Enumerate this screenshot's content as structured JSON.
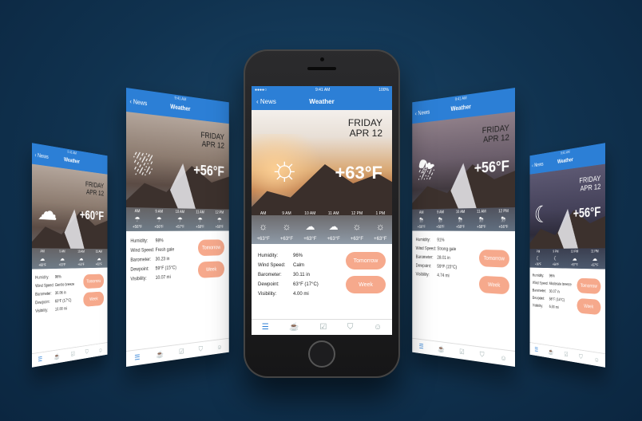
{
  "colors": {
    "accent": "#2c7fd6",
    "button": "#f6a98c",
    "background": "#10324f"
  },
  "screens": [
    {
      "status_time": "9:41 AM",
      "status_battery": "100%",
      "back": "News",
      "title": "Weather",
      "day": "FRIDAY",
      "date": "APR 12",
      "icon": "cloudy-icon",
      "temp": "+60°F",
      "hours": [
        {
          "time": "AM",
          "temp": "+60°F"
        },
        {
          "time": "9 AM",
          "temp": "+60°F"
        },
        {
          "time": "10 AM",
          "temp": "+63°F"
        },
        {
          "time": "11 AM",
          "temp": "+63°F"
        }
      ],
      "details": [
        {
          "key": "Humidity:",
          "val": "96%"
        },
        {
          "key": "Wind Speed:",
          "val": "Gentle breeze"
        },
        {
          "key": "Barometer:",
          "val": "30.06 in"
        },
        {
          "key": "Dewpoint:",
          "val": "63°F (17°C)"
        },
        {
          "key": "Visibility:",
          "val": "10.00 mi"
        }
      ],
      "buttons": [
        "Tomorrow",
        "Week"
      ]
    },
    {
      "status_time": "9:41 AM",
      "status_battery": "100%",
      "back": "News",
      "title": "Weather",
      "day": "FRIDAY",
      "date": "APR 12",
      "icon": "rain-icon",
      "temp": "+56°F",
      "hours": [
        {
          "time": "AM",
          "temp": "+56°F"
        },
        {
          "time": "9 AM",
          "temp": "+56°F"
        },
        {
          "time": "10 AM",
          "temp": "+57°F"
        },
        {
          "time": "11 AM",
          "temp": "+58°F"
        },
        {
          "time": "12 PM",
          "temp": "+58°F"
        }
      ],
      "details": [
        {
          "key": "Humidity:",
          "val": "98%"
        },
        {
          "key": "Wind Speed:",
          "val": "Fresh gale"
        },
        {
          "key": "Barometer:",
          "val": "30.23 in"
        },
        {
          "key": "Dewpoint:",
          "val": "59°F (15°C)"
        },
        {
          "key": "Visibility:",
          "val": "10.07 mi"
        }
      ],
      "buttons": [
        "Tomorrow",
        "Week"
      ]
    },
    {
      "status_time": "9:41 AM",
      "status_battery": "100%",
      "back": "News",
      "title": "Weather",
      "day": "FRIDAY",
      "date": "APR 12",
      "icon": "sun-icon",
      "temp": "+63°F",
      "hours": [
        {
          "time": "AM",
          "temp": "+63°F"
        },
        {
          "time": "9 AM",
          "temp": "+63°F"
        },
        {
          "time": "10 AM",
          "temp": "+63°F"
        },
        {
          "time": "11 AM",
          "temp": "+63°F"
        },
        {
          "time": "12 PM",
          "temp": "+63°F"
        },
        {
          "time": "1 PM",
          "temp": "+63°F"
        }
      ],
      "details": [
        {
          "key": "Humidity:",
          "val": "96%"
        },
        {
          "key": "Wind Speed:",
          "val": "Calm"
        },
        {
          "key": "Barometer:",
          "val": "30.11 in"
        },
        {
          "key": "Dewpoint:",
          "val": "63°F (17°C)"
        },
        {
          "key": "Visibility:",
          "val": "4.00 mi"
        }
      ],
      "buttons": [
        "Tomorrow",
        "Week"
      ]
    },
    {
      "status_time": "9:41 AM",
      "status_battery": "100%",
      "back": "News",
      "title": "Weather",
      "day": "FRIDAY",
      "date": "APR 12",
      "icon": "thunderstorm-icon",
      "temp": "+56°F",
      "hours": [
        {
          "time": "AM",
          "temp": "+56°F"
        },
        {
          "time": "9 AM",
          "temp": "+56°F"
        },
        {
          "time": "10 AM",
          "temp": "+58°F"
        },
        {
          "time": "11 AM",
          "temp": "+58°F"
        },
        {
          "time": "12 PM",
          "temp": "+56°F"
        }
      ],
      "details": [
        {
          "key": "Humidity:",
          "val": "91%"
        },
        {
          "key": "Wind Speed:",
          "val": "Strong gale"
        },
        {
          "key": "Barometer:",
          "val": "28.01 in"
        },
        {
          "key": "Dewpoint:",
          "val": "59°F (15°C)"
        },
        {
          "key": "Visibility:",
          "val": "4.74 mi"
        }
      ],
      "buttons": [
        "Tomorrow",
        "Week"
      ]
    },
    {
      "status_time": "9:41 AM",
      "status_battery": "100%",
      "back": "News",
      "title": "Weather",
      "day": "FRIDAY",
      "date": "APR 12",
      "icon": "moon-icon",
      "temp": "+56°F",
      "hours": [
        {
          "time": "PM",
          "temp": "+56°F"
        },
        {
          "time": "9 PM",
          "temp": "+56°F"
        },
        {
          "time": "10 PM",
          "temp": "+57°F"
        },
        {
          "time": "11 PM",
          "temp": "+57°F"
        }
      ],
      "details": [
        {
          "key": "Humidity:",
          "val": "96%"
        },
        {
          "key": "Wind Speed:",
          "val": "Moderate breeze"
        },
        {
          "key": "Barometer:",
          "val": "30.07 in"
        },
        {
          "key": "Dewpoint:",
          "val": "58°F (14°C)"
        },
        {
          "key": "Visibility:",
          "val": "6.00 mi"
        }
      ],
      "buttons": [
        "Tomorrow",
        "Week"
      ]
    }
  ]
}
